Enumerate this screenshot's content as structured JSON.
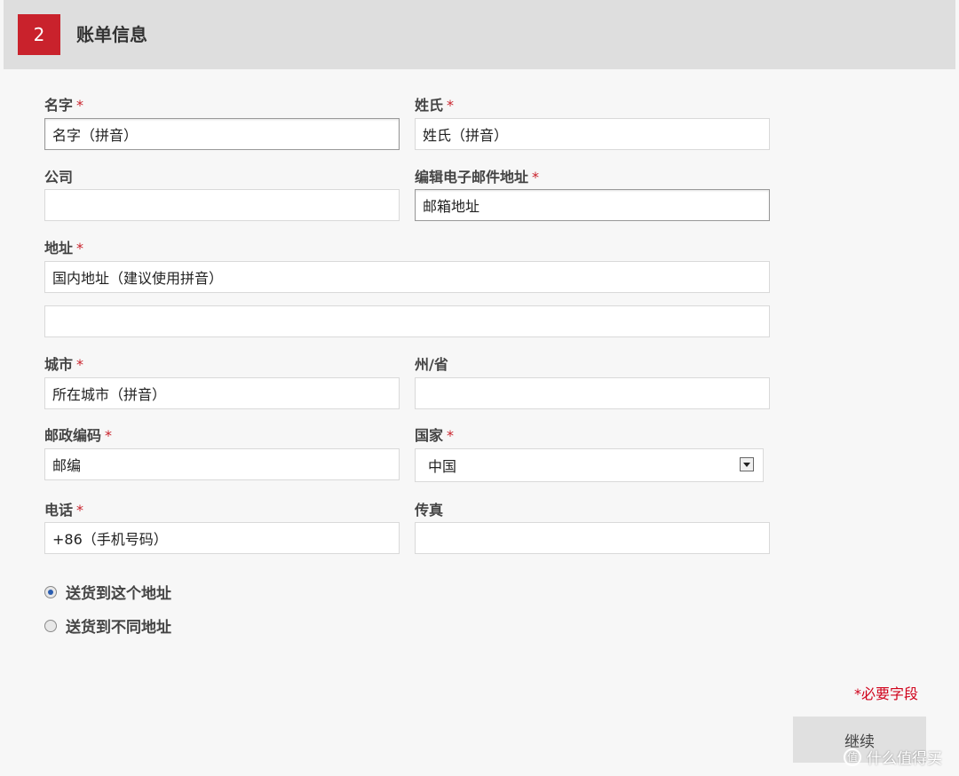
{
  "section": {
    "step": "2",
    "title": "账单信息"
  },
  "fields": {
    "first_name": {
      "label": "名字",
      "value": "名字（拼音）"
    },
    "last_name": {
      "label": "姓氏",
      "value": "姓氏（拼音）"
    },
    "company": {
      "label": "公司",
      "value": ""
    },
    "email": {
      "label": "编辑电子邮件地址",
      "value": "邮箱地址"
    },
    "address": {
      "label": "地址",
      "line1": "国内地址（建议使用拼音）",
      "line2": ""
    },
    "city": {
      "label": "城市",
      "value": "所在城市（拼音）"
    },
    "state": {
      "label": "州/省",
      "value": ""
    },
    "postcode": {
      "label": "邮政编码",
      "value": "邮编"
    },
    "country": {
      "label": "国家",
      "value": "中国"
    },
    "phone": {
      "label": "电话",
      "value": "+86（手机号码）"
    },
    "fax": {
      "label": "传真",
      "value": ""
    }
  },
  "required_mark": "*",
  "shipping_options": [
    {
      "label": "送货到这个地址",
      "checked": true
    },
    {
      "label": "送货到不同地址",
      "checked": false
    }
  ],
  "required_note": "*必要字段",
  "continue_label": "继续",
  "watermark": {
    "icon": "值",
    "text": "什么值得买"
  },
  "colors": {
    "accent": "#c9222c",
    "required_text": "#d0021b"
  }
}
